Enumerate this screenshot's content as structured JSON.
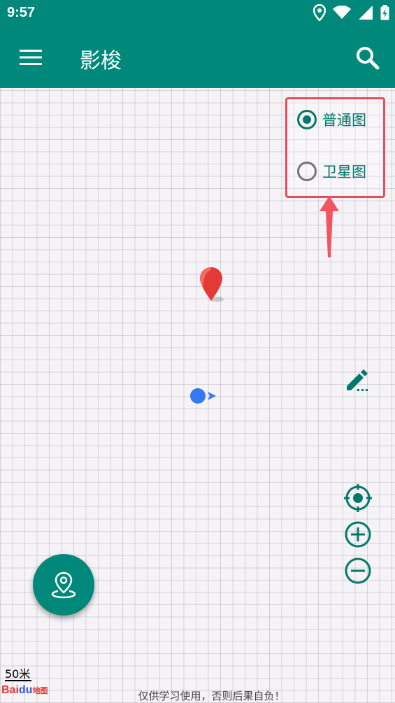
{
  "status_bar": {
    "time": "9:57",
    "icons": [
      "location-icon",
      "wifi-icon",
      "signal-icon",
      "battery-icon"
    ]
  },
  "app_bar": {
    "title": "影梭",
    "menu_icon": "menu-icon",
    "search_icon": "search-icon"
  },
  "map_type": {
    "options": [
      {
        "label": "普通图",
        "selected": true
      },
      {
        "label": "卫星图",
        "selected": false
      }
    ]
  },
  "map": {
    "scale_label": "50米",
    "logo_text": "Bai",
    "logo_du": "du",
    "logo_map": "地图",
    "disclaimer": "仅供学习使用，否则后果自负！"
  },
  "colors": {
    "primary": "#00897b",
    "accent": "#e84c55",
    "location_blue": "#3478f6",
    "marker_red": "#e53935"
  }
}
